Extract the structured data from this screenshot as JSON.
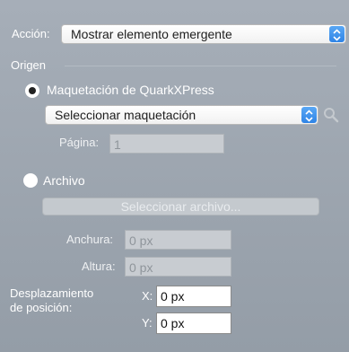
{
  "action": {
    "label": "Acción:",
    "selected": "Mostrar elemento emergente"
  },
  "origin": {
    "section_label": "Origen",
    "layout_option": {
      "label": "Maquetación de QuarkXPress",
      "selected": true,
      "popup_selected": "Seleccionar maquetación",
      "page_label": "Página:",
      "page_value": "1"
    },
    "file_option": {
      "label": "Archivo",
      "selected": false,
      "button_label": "Seleccionar archivo..."
    }
  },
  "size": {
    "width_label": "Anchura:",
    "width_value": "0 px",
    "height_label": "Altura:",
    "height_value": "0 px"
  },
  "offset": {
    "label_line1": "Desplazamiento",
    "label_line2": "de posición:",
    "x_label": "X:",
    "x_value": "0 px",
    "y_label": "Y:",
    "y_value": "0 px"
  },
  "icons": {
    "popup_stepper": "chevron-updown-icon",
    "search": "magnifier-icon"
  },
  "colors": {
    "accent": "#2f84e6",
    "panel": "#9aa3ad"
  }
}
